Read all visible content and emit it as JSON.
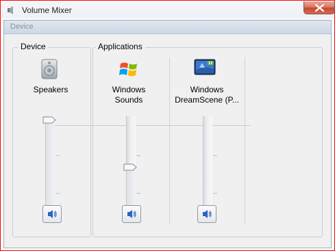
{
  "window": {
    "title": "Volume Mixer",
    "icon": "speaker-icon"
  },
  "menu": {
    "label": "Device"
  },
  "device_group": {
    "label": "Device",
    "items": [
      {
        "label": "Speakers",
        "icon": "speakers-icon",
        "volume_percent": 100
      }
    ]
  },
  "applications_group": {
    "label": "Applications",
    "items": [
      {
        "label": "Windows\nSounds",
        "icon": "windows-logo-icon",
        "volume_percent": 50
      },
      {
        "label": "Windows\nDreamScene (P...",
        "icon": "dreamscene-icon",
        "volume_percent": 0
      }
    ]
  },
  "colors": {
    "border_highlight": "#ff0000",
    "mute_icon": "#2b63c2"
  }
}
